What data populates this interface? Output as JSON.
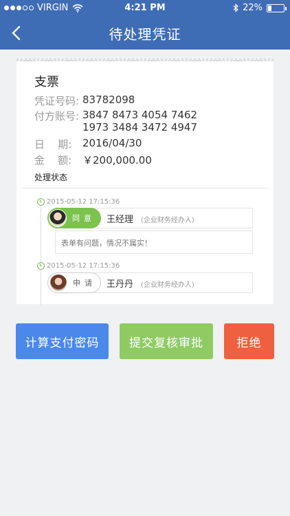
{
  "status_bar": {
    "carrier": "VIRGIN",
    "time": "4:21 PM",
    "battery": "22%",
    "battery_level": 0.22
  },
  "nav": {
    "title": "待处理凭证",
    "back_icon": "chevron-left-icon"
  },
  "voucher": {
    "type": "支票",
    "fields": {
      "voucher_no_label": "凭证号码:",
      "voucher_no": "83782098",
      "payer_label": "付方账号:",
      "payer_line1": "3847 8473 4054 7462",
      "payer_line2": "1973 3484 3472 4947",
      "date_label": "日    期:",
      "date": "2016/04/30",
      "amount_label": "金    额:",
      "amount": "￥200,000.00"
    },
    "status_heading": "处理状态"
  },
  "timeline": [
    {
      "time": "2015-05-12  17:15:36",
      "action": "同意",
      "name": "王经理",
      "role": "(企业财务经办人)",
      "comment": "表单有问题，情况不属实！"
    },
    {
      "time": "2015-05-12  17:15:36",
      "action": "申请",
      "name": "王丹丹",
      "role": "(企业财务经办人)"
    }
  ],
  "actions": {
    "calc_password": "计算支付密码",
    "submit_review": "提交复核审批",
    "reject": "拒绝"
  },
  "colors": {
    "header": "#3f6db5",
    "blue_button": "#4a89ea",
    "green_button": "#8fca63",
    "red_button": "#ef6040",
    "timeline_green": "#7cc24e"
  }
}
